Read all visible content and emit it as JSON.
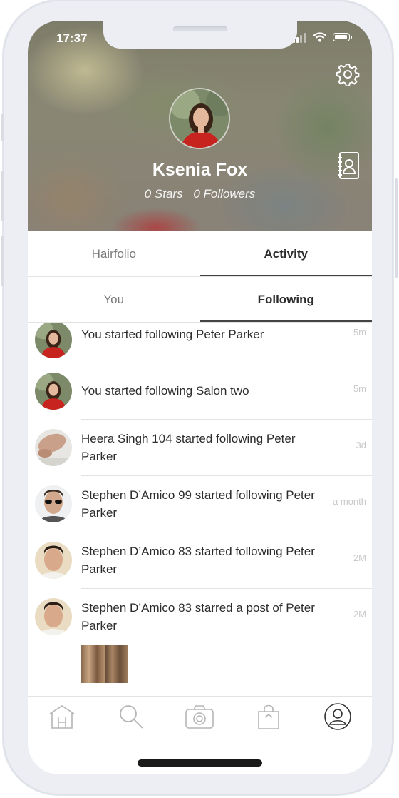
{
  "status": {
    "time": "17:37"
  },
  "profile": {
    "name": "Ksenia Fox",
    "stars": "0 Stars",
    "followers": "0 Followers"
  },
  "tabs_main": [
    {
      "label": "Hairfolio",
      "active": false
    },
    {
      "label": "Activity",
      "active": true
    }
  ],
  "tabs_sub": [
    {
      "label": "You",
      "active": false
    },
    {
      "label": "Following",
      "active": true
    }
  ],
  "feed": [
    {
      "text": "You started following Peter Parker",
      "time": "5m",
      "avatar": "ksenia"
    },
    {
      "text": "You started following Salon two",
      "time": "5m",
      "avatar": "ksenia"
    },
    {
      "text": "Heera Singh 104 started following Peter Parker",
      "time": "3d",
      "avatar": "hand"
    },
    {
      "text": "Stephen D’Amico 99 started following Peter Parker",
      "time": "a month",
      "avatar": "sunglasses"
    },
    {
      "text": "Stephen D’Amico 83 started following Peter Parker",
      "time": "2M",
      "avatar": "man"
    },
    {
      "text": "Stephen D’Amico 83 starred a post of Peter Parker",
      "time": "2M",
      "avatar": "man"
    }
  ],
  "icons": {
    "settings": "gear-icon",
    "contacts": "contact-book-icon",
    "nav": [
      "home-icon",
      "search-icon",
      "camera-icon",
      "shopping-bag-icon",
      "profile-icon"
    ]
  },
  "colors": {
    "text": "#2c2c2c",
    "muted": "#7a7a7a",
    "time": "#c9c9c9",
    "divider": "#e2e2e2",
    "frame": "#eceef3"
  }
}
